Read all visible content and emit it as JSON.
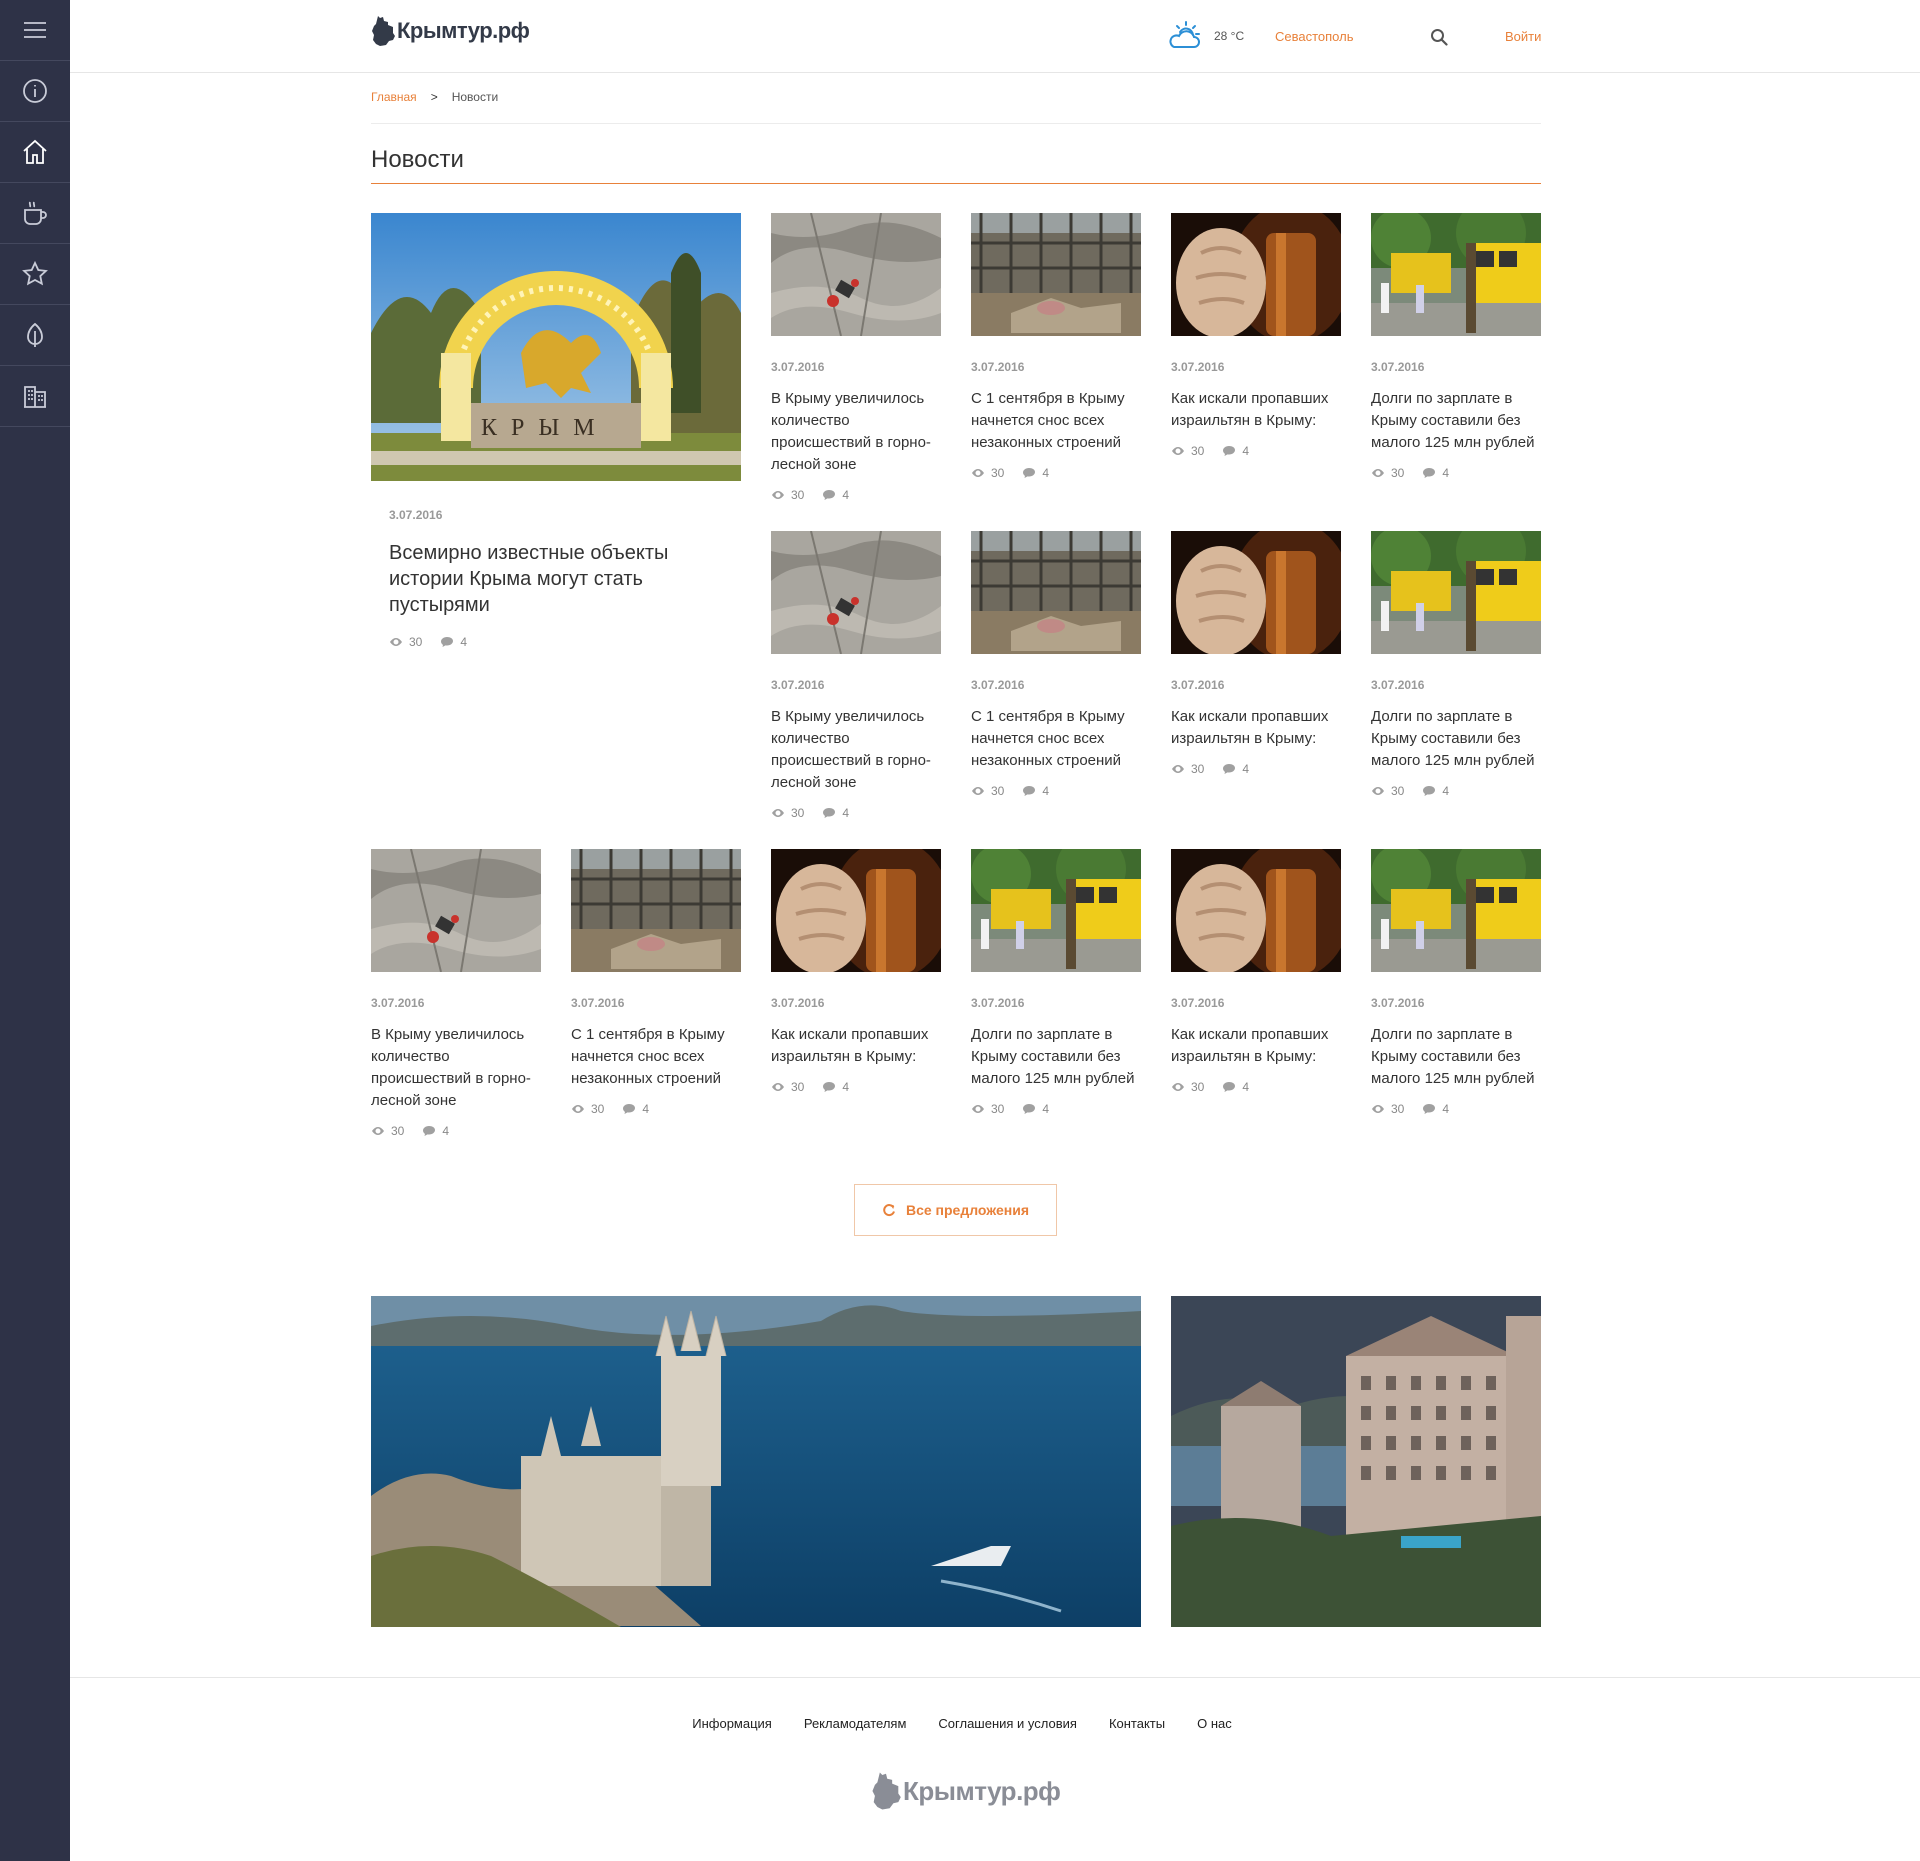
{
  "header": {
    "logo_text": "Крымтур.рф",
    "temperature": "28 °C",
    "city": "Севастополь",
    "login": "Войти"
  },
  "sidebar": {
    "items": [
      {
        "icon": "menu-icon"
      },
      {
        "icon": "info-icon"
      },
      {
        "icon": "home-icon"
      },
      {
        "icon": "coffee-cup-icon"
      },
      {
        "icon": "star-icon"
      },
      {
        "icon": "leaf-icon"
      },
      {
        "icon": "buildings-icon"
      }
    ]
  },
  "breadcrumb": {
    "home": "Главная",
    "separator": ">",
    "current": "Новости"
  },
  "page_title": "Новости",
  "featured": {
    "image": "crimea-monument",
    "date": "3.07.2016",
    "title": "Всемирно известные объекты истории Крыма могут стать пустырями",
    "views": "30",
    "comments": "4"
  },
  "news": [
    {
      "image": "rock",
      "date": "3.07.2016",
      "title": "В Крыму увеличилось количество происшествий в горно-лесной зоне",
      "views": "30",
      "comments": "4"
    },
    {
      "image": "demolition",
      "date": "3.07.2016",
      "title": "С 1 сентября в Крыму начнется снос всех незаконных строений",
      "views": "30",
      "comments": "4"
    },
    {
      "image": "gavel",
      "date": "3.07.2016",
      "title": "Как искали пропавших израильтян в Крыму:",
      "views": "30",
      "comments": "4"
    },
    {
      "image": "buses",
      "date": "3.07.2016",
      "title": "Долги по зарплате в Крыму составили без малого 125 млн рублей",
      "views": "30",
      "comments": "4"
    },
    {
      "image": "rock",
      "date": "3.07.2016",
      "title": "В Крыму увеличилось количество происшествий в горно-лесной зоне",
      "views": "30",
      "comments": "4"
    },
    {
      "image": "demolition",
      "date": "3.07.2016",
      "title": "С 1 сентября в Крыму начнется снос всех незаконных строений",
      "views": "30",
      "comments": "4"
    },
    {
      "image": "gavel",
      "date": "3.07.2016",
      "title": "Как искали пропавших израильтян в Крыму:",
      "views": "30",
      "comments": "4"
    },
    {
      "image": "buses",
      "date": "3.07.2016",
      "title": "Долги по зарплате в Крыму составили без малого 125 млн рублей",
      "views": "30",
      "comments": "4"
    },
    {
      "image": "rock",
      "date": "3.07.2016",
      "title": "В Крыму увеличилось количество происшествий в горно-лесной зоне",
      "views": "30",
      "comments": "4"
    },
    {
      "image": "demolition",
      "date": "3.07.2016",
      "title": "С 1 сентября в Крыму начнется снос всех незаконных строений",
      "views": "30",
      "comments": "4"
    },
    {
      "image": "gavel",
      "date": "3.07.2016",
      "title": "Как искали пропавших израильтян в Крыму:",
      "views": "30",
      "comments": "4"
    },
    {
      "image": "buses",
      "date": "3.07.2016",
      "title": "Долги по зарплате в Крыму составили без малого 125 млн рублей",
      "views": "30",
      "comments": "4"
    },
    {
      "image": "gavel",
      "date": "3.07.2016",
      "title": "Как искали пропавших израильтян в Крыму:",
      "views": "30",
      "comments": "4"
    },
    {
      "image": "buses",
      "date": "3.07.2016",
      "title": "Долги по зарплате в Крыму составили без малого 125 млн рублей",
      "views": "30",
      "comments": "4"
    }
  ],
  "more_button": "Все предложения",
  "banners": [
    {
      "image": "swallows-nest-castle"
    },
    {
      "image": "hotel-complex"
    }
  ],
  "footer": {
    "links": [
      "Информация",
      "Рекламодателям",
      "Соглашения и условия",
      "Контакты",
      "О нас"
    ],
    "logo_text": "Крымтур.рф"
  },
  "colors": {
    "accent": "#e8813a",
    "sidebar": "#2e3247"
  }
}
